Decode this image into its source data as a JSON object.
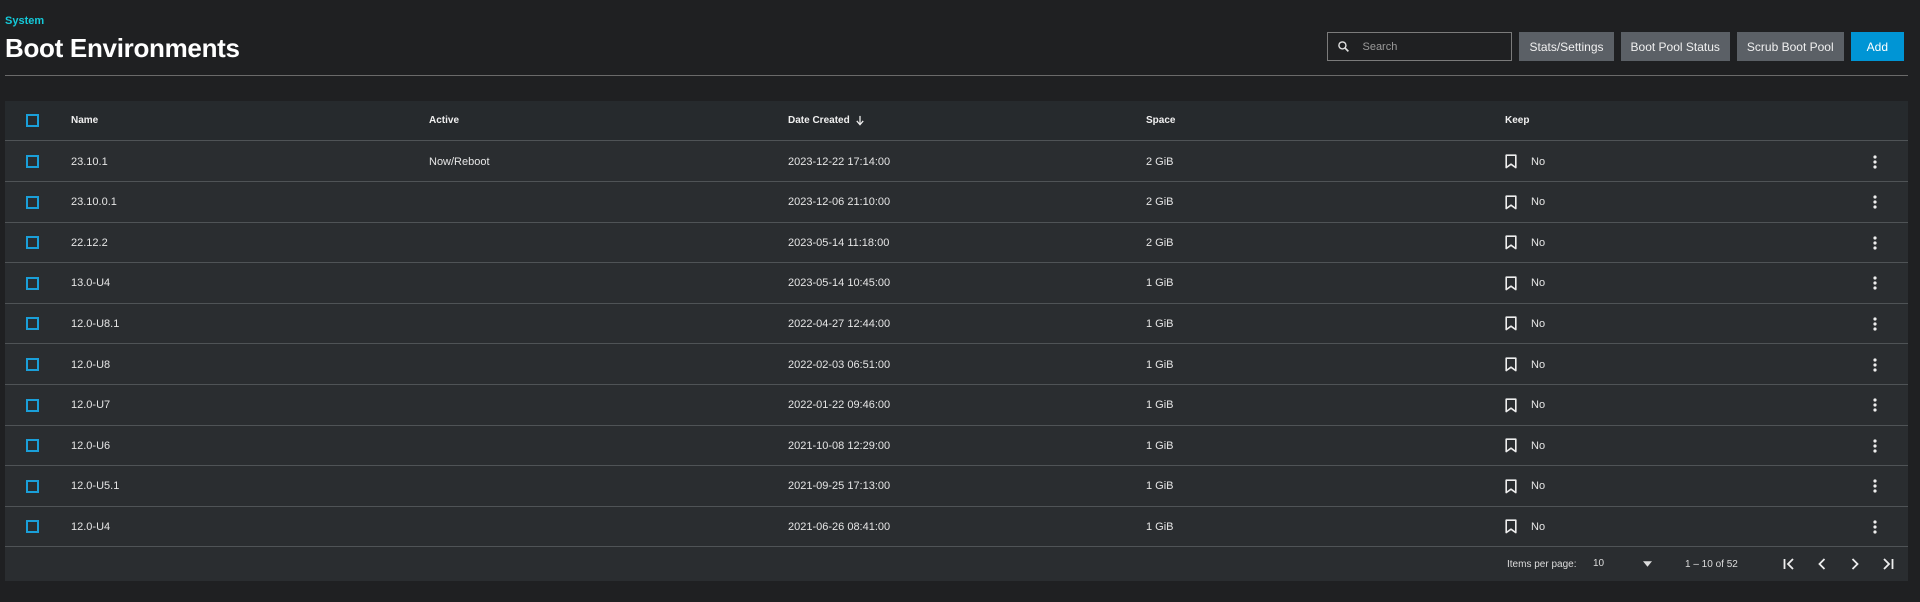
{
  "breadcrumb": "System",
  "title": "Boot Environments",
  "toolbar": {
    "search_placeholder": "Search",
    "stats_label": "Stats/Settings",
    "pool_status_label": "Boot Pool Status",
    "scrub_label": "Scrub Boot Pool",
    "add_label": "Add"
  },
  "table": {
    "headers": {
      "name": "Name",
      "active": "Active",
      "date": "Date Created",
      "space": "Space",
      "keep": "Keep"
    },
    "rows": [
      {
        "name": "23.10.1",
        "active": "Now/Reboot",
        "date": "2023-12-22 17:14:00",
        "space": "2 GiB",
        "keep": "No"
      },
      {
        "name": "23.10.0.1",
        "active": "",
        "date": "2023-12-06 21:10:00",
        "space": "2 GiB",
        "keep": "No"
      },
      {
        "name": "22.12.2",
        "active": "",
        "date": "2023-05-14 11:18:00",
        "space": "2 GiB",
        "keep": "No"
      },
      {
        "name": "13.0-U4",
        "active": "",
        "date": "2023-05-14 10:45:00",
        "space": "1 GiB",
        "keep": "No"
      },
      {
        "name": "12.0-U8.1",
        "active": "",
        "date": "2022-04-27 12:44:00",
        "space": "1 GiB",
        "keep": "No"
      },
      {
        "name": "12.0-U8",
        "active": "",
        "date": "2022-02-03 06:51:00",
        "space": "1 GiB",
        "keep": "No"
      },
      {
        "name": "12.0-U7",
        "active": "",
        "date": "2022-01-22 09:46:00",
        "space": "1 GiB",
        "keep": "No"
      },
      {
        "name": "12.0-U6",
        "active": "",
        "date": "2021-10-08 12:29:00",
        "space": "1 GiB",
        "keep": "No"
      },
      {
        "name": "12.0-U5.1",
        "active": "",
        "date": "2021-09-25 17:13:00",
        "space": "1 GiB",
        "keep": "No"
      },
      {
        "name": "12.0-U4",
        "active": "",
        "date": "2021-06-26 08:41:00",
        "space": "1 GiB",
        "keep": "No"
      }
    ]
  },
  "pagination": {
    "items_per_page_label": "Items per page:",
    "page_size": "10",
    "range": "1 – 10 of 52"
  }
}
